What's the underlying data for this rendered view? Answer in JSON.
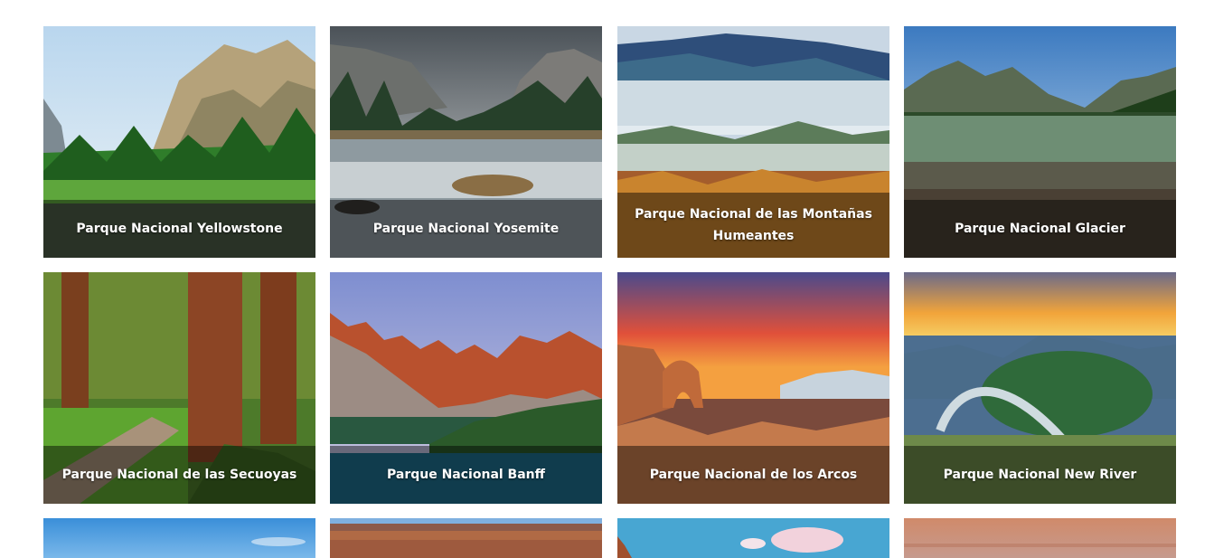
{
  "parks": [
    {
      "name": "Parque Nacional Yellowstone",
      "scene": "mountains-forest-river"
    },
    {
      "name": "Parque Nacional Yosemite",
      "scene": "granite-cliffs-river"
    },
    {
      "name": "Parque Nacional de las Montañas Humeantes",
      "scene": "misty-autumn-mountains"
    },
    {
      "name": "Parque Nacional Glacier",
      "scene": "mountain-lake"
    },
    {
      "name": "Parque Nacional de las Secuoyas",
      "scene": "sequoia-forest-boardwalk"
    },
    {
      "name": "Parque Nacional Banff",
      "scene": "rocky-peaks-turquoise-lake"
    },
    {
      "name": "Parque Nacional de los Arcos",
      "scene": "red-rock-arch-sunset"
    },
    {
      "name": "Parque Nacional New River",
      "scene": "river-bend-sunrise"
    }
  ],
  "partial_row": [
    {
      "scene": "blue-sky"
    },
    {
      "scene": "canyon-cliffs"
    },
    {
      "scene": "sky-clouds-rock"
    },
    {
      "scene": "sunset-sky"
    }
  ]
}
